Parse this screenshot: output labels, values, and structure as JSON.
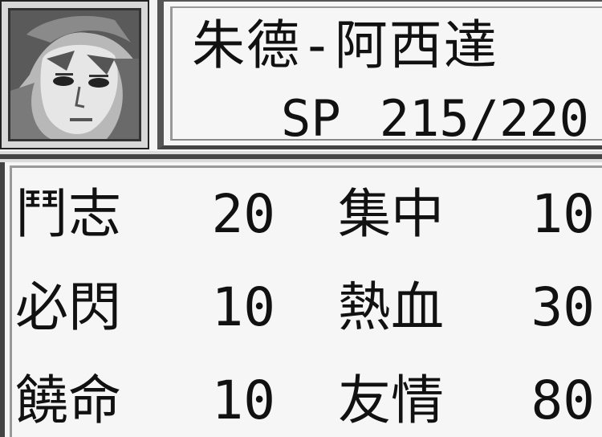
{
  "character": {
    "name": "朱德-阿西達",
    "sp_label": "SP",
    "sp_value": "215/220",
    "sp_current": 215,
    "sp_max": 220
  },
  "spirit_commands": [
    {
      "name": "鬥志",
      "cost": "20"
    },
    {
      "name": "集中",
      "cost": "10"
    },
    {
      "name": "必閃",
      "cost": "10"
    },
    {
      "name": "熱血",
      "cost": "30"
    },
    {
      "name": "饒命",
      "cost": "10"
    },
    {
      "name": "友情",
      "cost": "80"
    }
  ],
  "colors": {
    "background": "#f4f4f4",
    "text": "#111111",
    "frame_dark": "#444444",
    "frame_light": "#999999"
  }
}
